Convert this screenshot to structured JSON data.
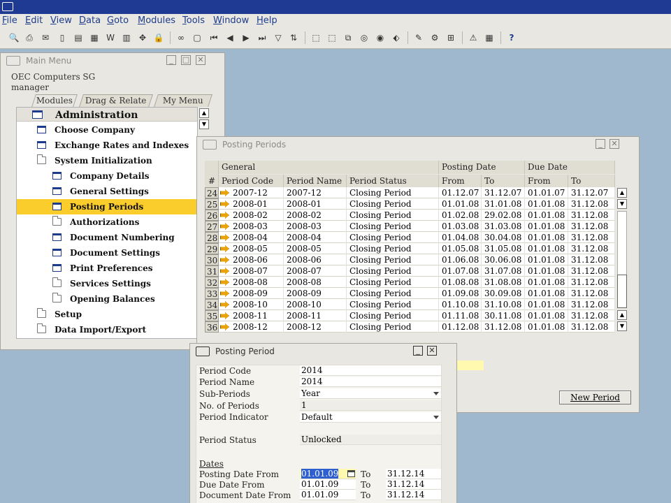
{
  "menu": [
    "File",
    "Edit",
    "View",
    "Data",
    "Goto",
    "Modules",
    "Tools",
    "Window",
    "Help"
  ],
  "toolbar_icons": [
    "preview-icon",
    "print-icon",
    "email-icon",
    "sms-icon",
    "fax-icon",
    "excel-icon",
    "word-icon",
    "pdf-icon",
    "find-icon",
    "lock-icon",
    "binoculars-icon",
    "add-icon",
    "first-record-icon",
    "previous-record-icon",
    "next-record-icon",
    "last-record-icon",
    "filter-icon",
    "sort-icon",
    "base-document-icon",
    "target-document-icon",
    "drag-relate-icon",
    "journal-icon",
    "gross-profit-icon",
    "settings-icon",
    "layout-designer-icon",
    "form-settings-icon",
    "alerts-icon",
    "calendar-icon",
    "help-icon"
  ],
  "main_menu": {
    "title": "Main Menu",
    "company": "OEC Computers SG",
    "user": "manager",
    "tabs": [
      "Modules",
      "Drag & Relate",
      "My Menu"
    ],
    "header": "Administration",
    "items": [
      {
        "label": "Choose Company",
        "icon": "doc",
        "level": 0
      },
      {
        "label": "Exchange Rates and Indexes",
        "icon": "doc",
        "level": 0
      },
      {
        "label": "System Initialization",
        "icon": "folder",
        "level": 0
      },
      {
        "label": "Company Details",
        "icon": "doc",
        "level": 1
      },
      {
        "label": "General Settings",
        "icon": "doc",
        "level": 1
      },
      {
        "label": "Posting Periods",
        "icon": "doc",
        "level": 1,
        "selected": true
      },
      {
        "label": "Authorizations",
        "icon": "folder",
        "level": 1
      },
      {
        "label": "Document Numbering",
        "icon": "doc",
        "level": 1
      },
      {
        "label": "Document Settings",
        "icon": "doc",
        "level": 1
      },
      {
        "label": "Print Preferences",
        "icon": "doc",
        "level": 1
      },
      {
        "label": "Services Settings",
        "icon": "folder",
        "level": 1
      },
      {
        "label": "Opening Balances",
        "icon": "folder",
        "level": 1
      },
      {
        "label": "Setup",
        "icon": "folder",
        "level": 0
      },
      {
        "label": "Data Import/Export",
        "icon": "folder",
        "level": 0
      }
    ]
  },
  "periods_window": {
    "title": "Posting Periods",
    "group_headers": [
      "General",
      "Posting Date",
      "Due Date"
    ],
    "columns": [
      "#",
      "Period Code",
      "Period Name",
      "Period Status",
      "From",
      "To",
      "From",
      "To"
    ],
    "rows": [
      [
        "24",
        "2007-12",
        "2007-12",
        "Closing Period",
        "01.12.07",
        "31.12.07",
        "01.01.07",
        "31.12.07"
      ],
      [
        "25",
        "2008-01",
        "2008-01",
        "Closing Period",
        "01.01.08",
        "31.01.08",
        "01.01.08",
        "31.12.08"
      ],
      [
        "26",
        "2008-02",
        "2008-02",
        "Closing Period",
        "01.02.08",
        "29.02.08",
        "01.01.08",
        "31.12.08"
      ],
      [
        "27",
        "2008-03",
        "2008-03",
        "Closing Period",
        "01.03.08",
        "31.03.08",
        "01.01.08",
        "31.12.08"
      ],
      [
        "28",
        "2008-04",
        "2008-04",
        "Closing Period",
        "01.04.08",
        "30.04.08",
        "01.01.08",
        "31.12.08"
      ],
      [
        "29",
        "2008-05",
        "2008-05",
        "Closing Period",
        "01.05.08",
        "31.05.08",
        "01.01.08",
        "31.12.08"
      ],
      [
        "30",
        "2008-06",
        "2008-06",
        "Closing Period",
        "01.06.08",
        "30.06.08",
        "01.01.08",
        "31.12.08"
      ],
      [
        "31",
        "2008-07",
        "2008-07",
        "Closing Period",
        "01.07.08",
        "31.07.08",
        "01.01.08",
        "31.12.08"
      ],
      [
        "32",
        "2008-08",
        "2008-08",
        "Closing Period",
        "01.08.08",
        "31.08.08",
        "01.01.08",
        "31.12.08"
      ],
      [
        "33",
        "2008-09",
        "2008-09",
        "Closing Period",
        "01.09.08",
        "30.09.08",
        "01.01.08",
        "31.12.08"
      ],
      [
        "34",
        "2008-10",
        "2008-10",
        "Closing Period",
        "01.10.08",
        "31.10.08",
        "01.01.08",
        "31.12.08"
      ],
      [
        "35",
        "2008-11",
        "2008-11",
        "Closing Period",
        "01.11.08",
        "30.11.08",
        "01.01.08",
        "31.12.08"
      ],
      [
        "36",
        "2008-12",
        "2008-12",
        "Closing Period",
        "01.12.08",
        "31.12.08",
        "01.01.08",
        "31.12.08"
      ]
    ],
    "new_period_button": "New Period"
  },
  "period_form": {
    "title": "Posting Period",
    "period_code_label": "Period Code",
    "period_code": "2014",
    "period_name_label": "Period Name",
    "period_name": "2014",
    "sub_periods_label": "Sub-Periods",
    "sub_periods": "Year",
    "num_periods_label": "No. of Periods",
    "num_periods": "1",
    "period_indicator_label": "Period Indicator",
    "period_indicator": "Default",
    "period_status_label": "Period Status",
    "period_status": "Unlocked",
    "dates_label": "Dates",
    "to_label": "To",
    "posting_from_label": "Posting Date From",
    "posting_from": "01.01.09",
    "posting_to": "31.12.14",
    "due_from_label": "Due Date From",
    "due_from": "01.01.09",
    "due_to": "31.12.14",
    "doc_from_label": "Document Date From",
    "doc_from": "01.01.09",
    "doc_to": "31.12.14"
  }
}
